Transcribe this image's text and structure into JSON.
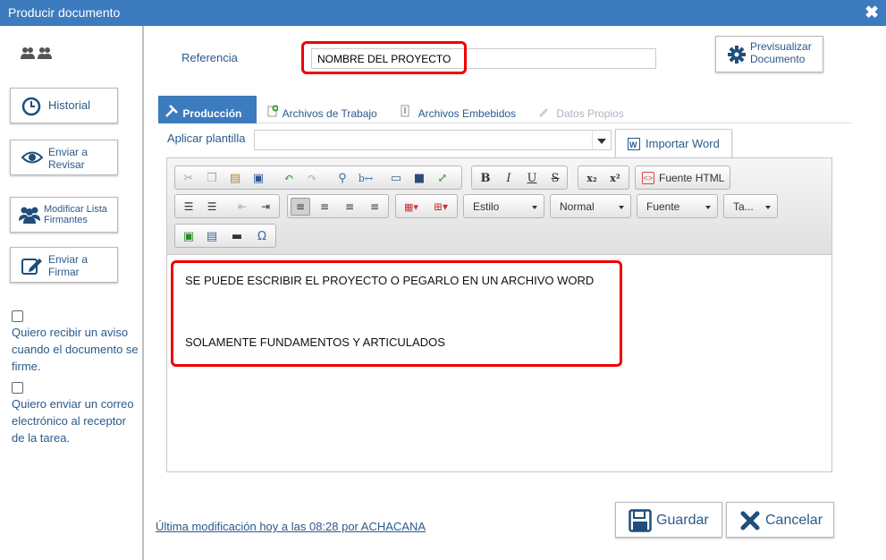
{
  "window": {
    "title": "Producir documento"
  },
  "sidebar": {
    "historial": "Historial",
    "enviar_revisar": "Enviar a Revisar",
    "modificar_firmantes": "Modificar Lista Firmantes",
    "enviar_firmar": "Enviar a Firmar",
    "checkbox_aviso": "Quiero recibir un aviso cuando el documento se firme.",
    "checkbox_correo": "Quiero enviar un correo electrónico al receptor de la tarea."
  },
  "header": {
    "referencia_label": "Referencia",
    "referencia_value": "NOMBRE DEL PROYECTO",
    "previsualizar": "Previsualizar Documento"
  },
  "tabs": [
    {
      "label": "Producción"
    },
    {
      "label": "Archivos de Trabajo"
    },
    {
      "label": "Archivos Embebidos"
    },
    {
      "label": "Datos Propios"
    }
  ],
  "plantilla": {
    "label": "Aplicar plantilla",
    "value": ""
  },
  "importar_word": "Importar Word",
  "toolbar": {
    "fuente_html": "Fuente HTML",
    "estilo": "Estilo",
    "normal": "Normal",
    "fuente": "Fuente",
    "tamano": "Ta..."
  },
  "content": {
    "line1": "SE PUEDE ESCRIBIR EL PROYECTO O PEGARLO EN UN ARCHIVO WORD",
    "line2": "SOLAMENTE FUNDAMENTOS Y ARTICULADOS"
  },
  "footer": {
    "last_modified": "Última modificación hoy a las 08:28 por ACHACANA",
    "guardar": "Guardar",
    "cancelar": "Cancelar"
  },
  "colors": {
    "accent": "#3c7bbd",
    "highlight": "#ee0000",
    "link": "#2a5a8a"
  }
}
